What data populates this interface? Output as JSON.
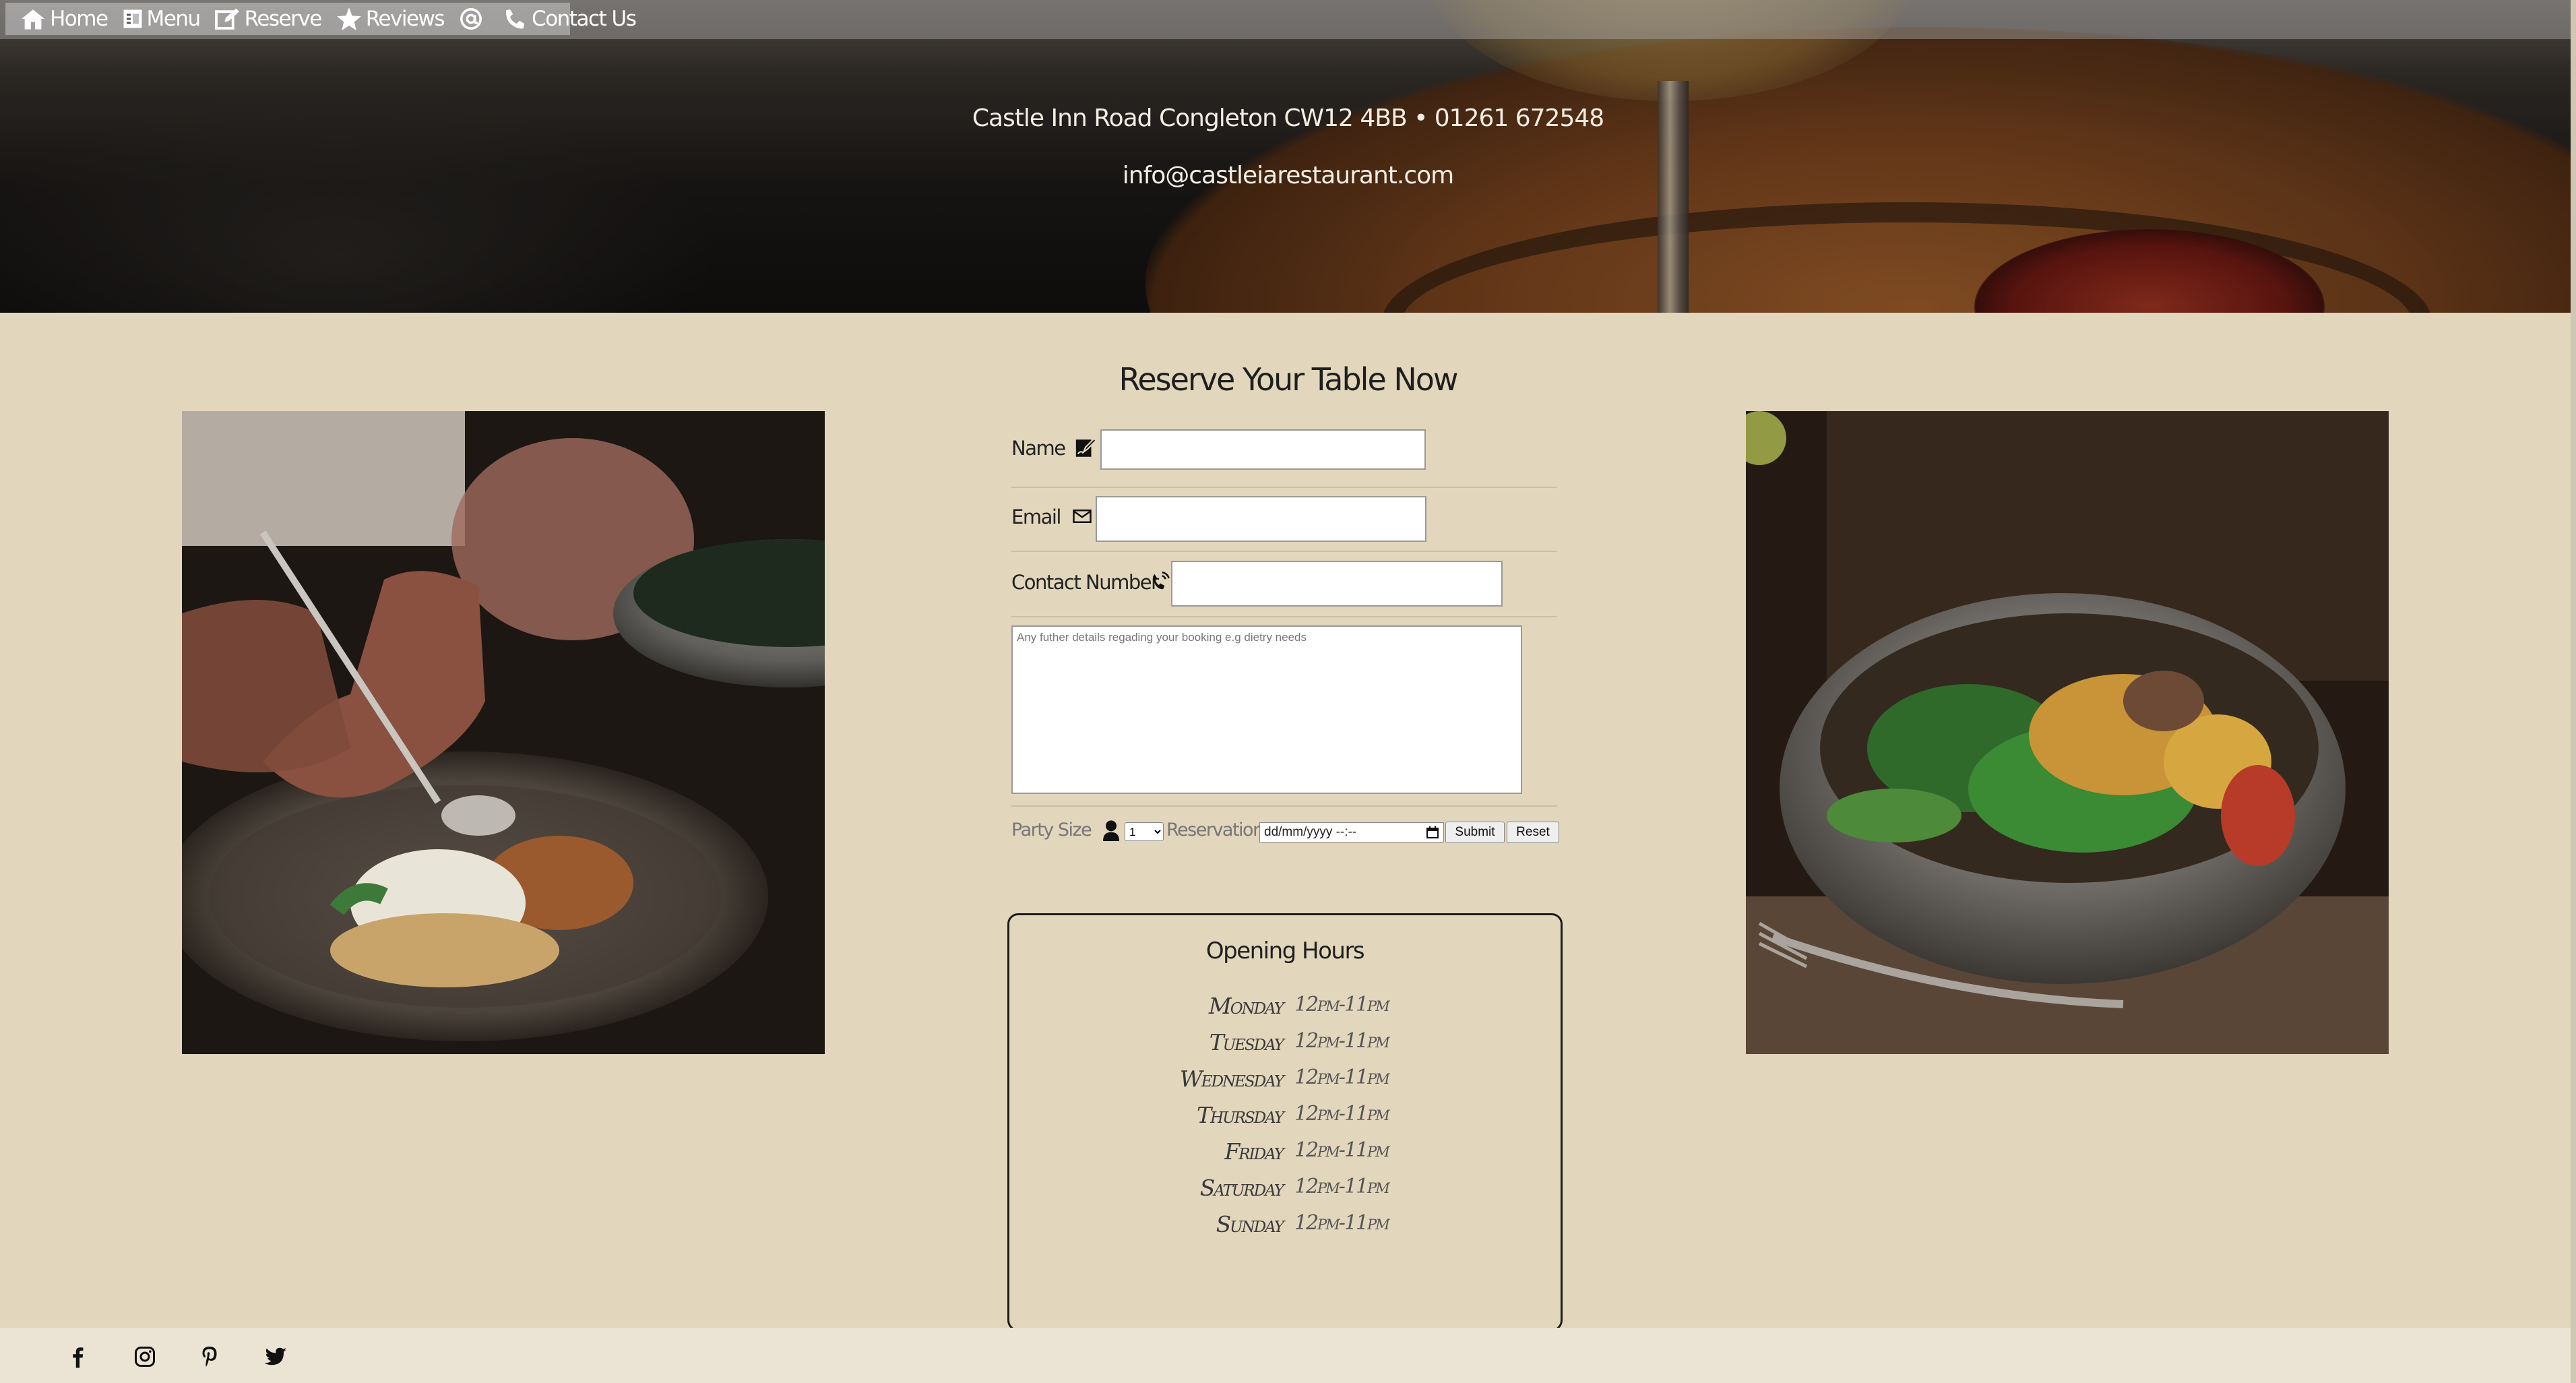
{
  "nav": {
    "items": [
      {
        "label": "Home",
        "icon": "home-icon"
      },
      {
        "label": "Menu",
        "icon": "menu-book-icon"
      },
      {
        "label": "Reserve",
        "icon": "edit-icon"
      },
      {
        "label": "Reviews",
        "icon": "star-icon"
      },
      {
        "label": "",
        "icon": "at-sign-icon"
      },
      {
        "label": "Contact Us",
        "icon": "phone-icon"
      }
    ]
  },
  "hero": {
    "address": "Castle Inn Road Congleton CW12 4BB • 01261 672548",
    "email": "info@castleiarestaurant.com"
  },
  "reserve": {
    "title": "Reserve Your Table Now",
    "name_label": "Name",
    "email_label": "Email",
    "contact_label": "Contact Number",
    "details_placeholder": "Any futher details regading your booking e.g dietry needs",
    "party_label": "Party Size",
    "party_value": "1",
    "reservation_label": "Reservation:",
    "date_value": "dd/mm/yyyy --:--",
    "submit_label": "Submit",
    "reset_label": "Reset"
  },
  "hours": {
    "title": "Opening Hours",
    "days": [
      {
        "day": "Monday",
        "time": "12pm-11pm"
      },
      {
        "day": "Tuesday",
        "time": "12pm-11pm"
      },
      {
        "day": "Wednesday",
        "time": "12pm-11pm"
      },
      {
        "day": "Thursday",
        "time": "12pm-11pm"
      },
      {
        "day": "Friday",
        "time": "12pm-11pm"
      },
      {
        "day": "Saturday",
        "time": "12pm-11pm"
      },
      {
        "day": "Sunday",
        "time": "12pm-11pm"
      }
    ]
  },
  "footer": {
    "social": [
      "facebook-icon",
      "instagram-icon",
      "pinterest-icon",
      "twitter-icon"
    ]
  },
  "colors": {
    "page_bg": "#e2d6bc",
    "footer_bg": "#ebe4d4",
    "text_dark": "#1f1f1f"
  }
}
